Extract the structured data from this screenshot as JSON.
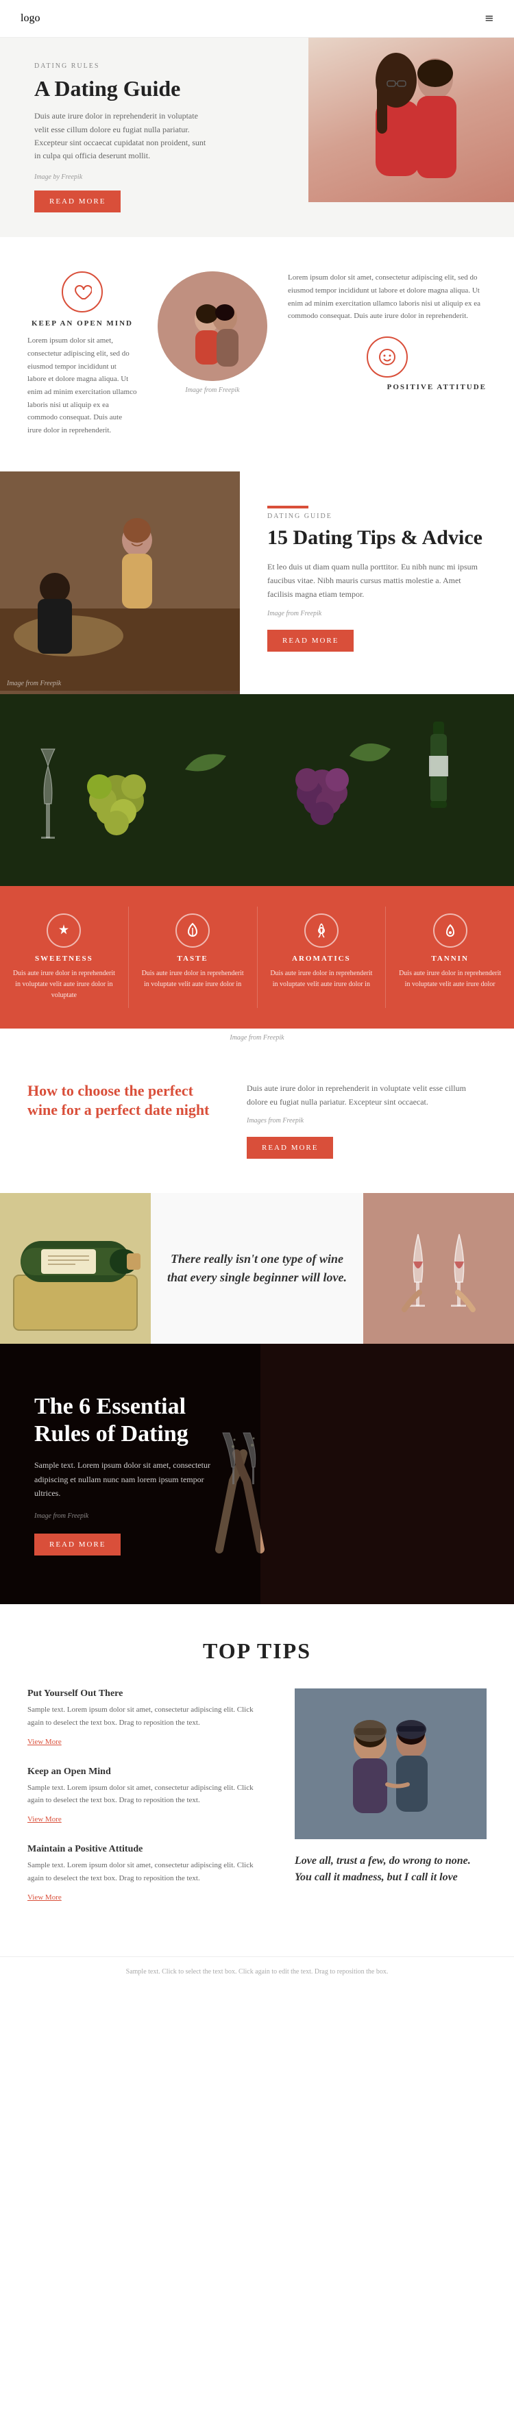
{
  "nav": {
    "logo": "logo",
    "menu_icon": "≡"
  },
  "hero": {
    "tag": "DATING RULES",
    "title": "A Dating Guide",
    "description": "Duis aute irure dolor in reprehenderit in voluptate velit esse cillum dolore eu fugiat nulla pariatur. Excepteur sint occaecat cupidatat non proident, sunt in culpa qui officia deserunt mollit.",
    "image_credit": "Image by Freepik",
    "read_more": "READ MORE"
  },
  "open_mind": {
    "icon_symbol": "♡",
    "label": "KEEP AN OPEN MIND",
    "text": "Lorem ipsum dolor sit amet, consectetur adipiscing elit, sed do eiusmod tempor incididunt ut labore et dolore magna aliqua. Ut enim ad minim exercitation ullamco laboris nisi ut aliquip ex ea commodo consequat. Duis aute irure dolor in reprehenderit.",
    "image_credit": "Image from Freepik",
    "right_text": "Lorem ipsum dolor sit amet, consectetur adipiscing elit, sed do eiusmod tempor incididunt ut labore et dolore magna aliqua. Ut enim ad minim exercitation ullamco laboris nisi ut aliquip ex ea commodo consequat. Duis aute irure dolor in reprehenderit.",
    "positive_icon": "☺",
    "positive_label": "POSITIVE ATTITUDE"
  },
  "dating_tips": {
    "tag": "DATING GUIDE",
    "title": "15 Dating Tips & Advice",
    "text": "Et leo duis ut diam quam nulla porttitor. Eu nibh nunc mi ipsum faucibus vitae. Nibh mauris cursus mattis molestie a. Amet facilisis magna etiam tempor.",
    "image_credit": "Image from Freepik",
    "read_more": "READ MORE"
  },
  "wine_section": {
    "banner_alt": "Wine and grapes banner image",
    "image_credit": "Image from Freepik",
    "attributes": [
      {
        "icon": "✦",
        "label": "SWEETNESS",
        "text": "Duis aute irure dolor in reprehenderit in voluptate velit aute irure dolor in voluptate"
      },
      {
        "icon": "◈",
        "label": "TASTE",
        "text": "Duis aute irure dolor in reprehenderit in voluptate velit aute irure dolor in"
      },
      {
        "icon": "❋",
        "label": "AROMATICS",
        "text": "Duis aute irure dolor in reprehenderit in voluptate velit aute irure dolor in"
      },
      {
        "icon": "⊕",
        "label": "TANNIN",
        "text": "Duis aute irure dolor in reprehenderit in voluptate velit aute irure dolor"
      }
    ]
  },
  "wine_choice": {
    "title": "How to choose the perfect wine for a perfect date night",
    "text": "Duis aute irure dolor in reprehenderit in voluptate velit esse cillum dolore eu fugiat nulla pariatur. Excepteur sint occaecat.",
    "image_credits": "Images from Freepik",
    "read_more": "READ MORE",
    "quote": "There really isn't one type of wine that every single beginner will love."
  },
  "essential_rules": {
    "title": "The 6 Essential Rules of Dating",
    "text": "Sample text. Lorem ipsum dolor sit amet, consectetur adipiscing et nullam nunc nam lorem ipsum tempor ultrices.",
    "credits": "Image from Freepik",
    "read_more": "READ MORE"
  },
  "top_tips": {
    "heading": "TOP TIPS",
    "tips": [
      {
        "title": "Put Yourself Out There",
        "text": "Sample text. Lorem ipsum dolor sit amet, consectetur adipiscing elit. Click again to deselect the text box. Drag to reposition the text.",
        "link": "View More"
      },
      {
        "title": "Keep an Open Mind",
        "text": "Sample text. Lorem ipsum dolor sit amet, consectetur adipiscing elit. Click again to deselect the text box. Drag to reposition the text.",
        "link": "View More"
      },
      {
        "title": "Maintain a Positive Attitude",
        "text": "Sample text. Lorem ipsum dolor sit amet, consectetur adipiscing elit. Click again to deselect the text box. Drag to reposition the text.",
        "link": "View More"
      }
    ],
    "quote": "Love all, trust a few, do wrong to none. You call it madness, but I call it love"
  },
  "bottom_bar": {
    "text": "Sample text. Click to select the text box. Click again to edit the text. Drag to reposition the box."
  }
}
